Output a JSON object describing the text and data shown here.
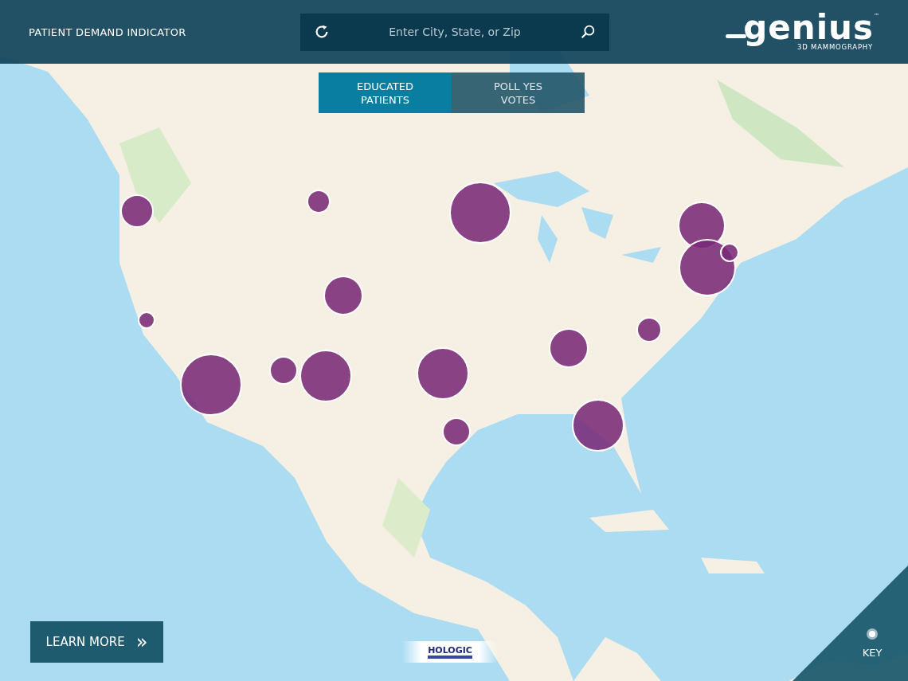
{
  "header": {
    "title": "PATIENT DEMAND INDICATOR",
    "search": {
      "placeholder": "Enter City, State, or Zip"
    },
    "logo": {
      "wordmark": "genius",
      "trademark": "™",
      "tagline": "3D MAMMOGRAPHY"
    }
  },
  "tabs": [
    {
      "label": "EDUCATED PATIENTS",
      "selected": true
    },
    {
      "label": "POLL YES VOTES",
      "selected": false
    }
  ],
  "learn_more": {
    "label": "LEARN MORE",
    "arrow": "»"
  },
  "sponsor_logo": {
    "text": "HOLOGIC"
  },
  "key": {
    "label": "KEY"
  }
}
